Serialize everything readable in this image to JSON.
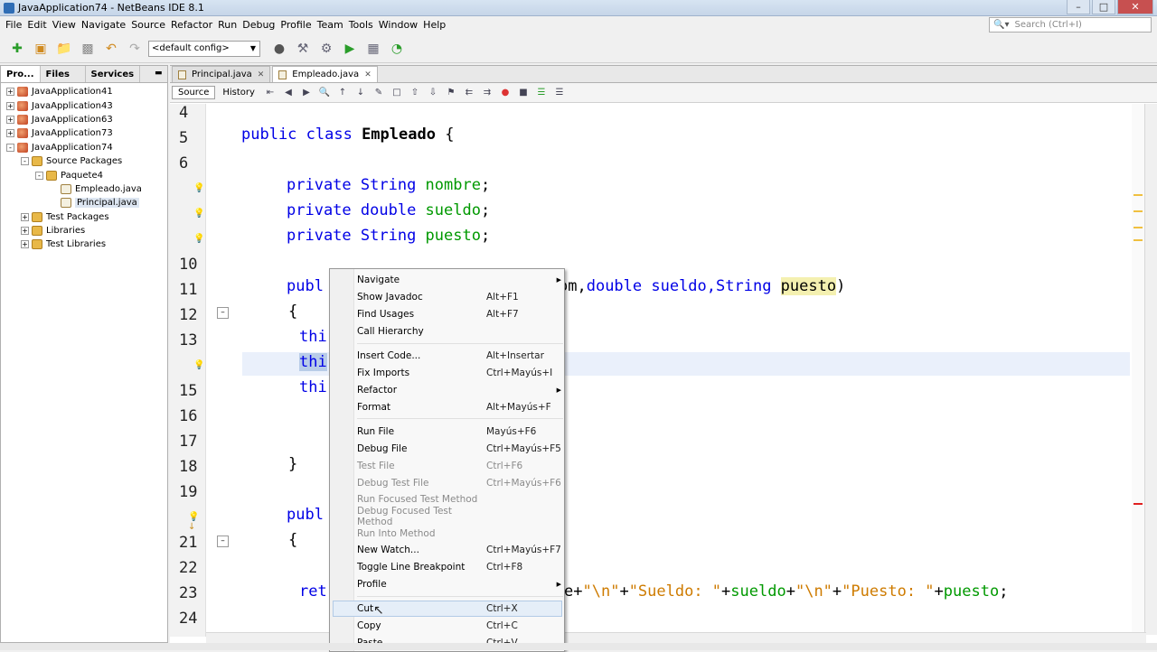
{
  "window": {
    "title": "JavaApplication74 - NetBeans IDE 8.1"
  },
  "menubar": [
    "File",
    "Edit",
    "View",
    "Navigate",
    "Source",
    "Refactor",
    "Run",
    "Debug",
    "Profile",
    "Team",
    "Tools",
    "Window",
    "Help"
  ],
  "search": {
    "placeholder": "Search (Ctrl+I)"
  },
  "toolbar": {
    "config_value": "<default config>"
  },
  "project_panel": {
    "tabs": [
      "Pro...",
      "Files",
      "Services"
    ],
    "tree": [
      {
        "label": "JavaApplication41",
        "depth": 0,
        "toggle": "+",
        "icon": "proj"
      },
      {
        "label": "JavaApplication43",
        "depth": 0,
        "toggle": "+",
        "icon": "proj"
      },
      {
        "label": "JavaApplication63",
        "depth": 0,
        "toggle": "+",
        "icon": "proj"
      },
      {
        "label": "JavaApplication73",
        "depth": 0,
        "toggle": "+",
        "icon": "proj"
      },
      {
        "label": "JavaApplication74",
        "depth": 0,
        "toggle": "-",
        "icon": "proj"
      },
      {
        "label": "Source Packages",
        "depth": 1,
        "toggle": "-",
        "icon": "pkg"
      },
      {
        "label": "Paquete4",
        "depth": 2,
        "toggle": "-",
        "icon": "pkg"
      },
      {
        "label": "Empleado.java",
        "depth": 3,
        "toggle": "",
        "icon": "file"
      },
      {
        "label": "Principal.java",
        "depth": 3,
        "toggle": "",
        "icon": "file",
        "selected": true
      },
      {
        "label": "Test Packages",
        "depth": 1,
        "toggle": "+",
        "icon": "pkg"
      },
      {
        "label": "Libraries",
        "depth": 1,
        "toggle": "+",
        "icon": "pkg"
      },
      {
        "label": "Test Libraries",
        "depth": 1,
        "toggle": "+",
        "icon": "pkg"
      }
    ]
  },
  "editor": {
    "tabs": [
      "Principal.java",
      "Empleado.java"
    ],
    "source_label": "Source",
    "history_label": "History",
    "line_numbers": [
      "4",
      "5",
      "6",
      "",
      "",
      "",
      "10",
      "11",
      "12",
      "13",
      "",
      "15",
      "16",
      "17",
      "18",
      "19",
      "",
      "21",
      "22",
      "23",
      "24"
    ],
    "code": {
      "class_decl_kw": "public class ",
      "class_name": "Empleado",
      "class_brace": " {",
      "private_kw": "private ",
      "t_string": "String ",
      "t_double": "double ",
      "f_nombre": "nombre",
      "f_sueldo": "sueldo",
      "f_puesto": "puesto",
      "semi": ";",
      "publ": "publ",
      "ctor_tail_a": "om,",
      "ctor_tail_b": "double sueldo,",
      "ctor_tail_c": "String ",
      "ctor_tail_d": "puesto",
      "ctor_tail_e": ")",
      "brace_open": "{",
      "brace_close": "}",
      "thi": "thi",
      "ret": "ret",
      "ret_tail_a": "e+",
      "ret_s1": "\"\\n\"",
      "plus": "+",
      "ret_s2": "\"Sueldo: \"",
      "ret_s3": "\"\\n\"",
      "ret_s4": "\"Puesto: \"",
      "ret_sueldo": "sueldo",
      "ret_puesto": "puesto"
    }
  },
  "context_menu": {
    "items": [
      {
        "label": "Navigate",
        "shortcut": "",
        "submenu": true,
        "disabled": false
      },
      {
        "label": "Show Javadoc",
        "shortcut": "Alt+F1",
        "disabled": false
      },
      {
        "label": "Find Usages",
        "shortcut": "Alt+F7",
        "disabled": false
      },
      {
        "label": "Call Hierarchy",
        "shortcut": "",
        "disabled": false
      },
      {
        "label": "Insert Code...",
        "shortcut": "Alt+Insertar",
        "disabled": false
      },
      {
        "label": "Fix Imports",
        "shortcut": "Ctrl+Mayús+I",
        "disabled": false
      },
      {
        "label": "Refactor",
        "shortcut": "",
        "submenu": true,
        "disabled": false
      },
      {
        "label": "Format",
        "shortcut": "Alt+Mayús+F",
        "disabled": false
      },
      {
        "label": "Run File",
        "shortcut": "Mayús+F6",
        "disabled": false
      },
      {
        "label": "Debug File",
        "shortcut": "Ctrl+Mayús+F5",
        "disabled": false
      },
      {
        "label": "Test File",
        "shortcut": "Ctrl+F6",
        "disabled": true
      },
      {
        "label": "Debug Test File",
        "shortcut": "Ctrl+Mayús+F6",
        "disabled": true
      },
      {
        "label": "Run Focused Test Method",
        "shortcut": "",
        "disabled": true
      },
      {
        "label": "Debug Focused Test Method",
        "shortcut": "",
        "disabled": true
      },
      {
        "label": "Run Into Method",
        "shortcut": "",
        "disabled": true
      },
      {
        "label": "New Watch...",
        "shortcut": "Ctrl+Mayús+F7",
        "disabled": false
      },
      {
        "label": "Toggle Line Breakpoint",
        "shortcut": "Ctrl+F8",
        "disabled": false
      },
      {
        "label": "Profile",
        "shortcut": "",
        "submenu": true,
        "disabled": false
      },
      {
        "label": "Cut",
        "shortcut": "Ctrl+X",
        "disabled": false,
        "hover": true
      },
      {
        "label": "Copy",
        "shortcut": "Ctrl+C",
        "disabled": false
      },
      {
        "label": "Paste",
        "shortcut": "Ctrl+V",
        "disabled": false
      }
    ]
  },
  "colors": {
    "keyword": "#0000e6",
    "field": "#009900",
    "string": "#ce7b00",
    "menu_hover": "#e5eef8"
  }
}
